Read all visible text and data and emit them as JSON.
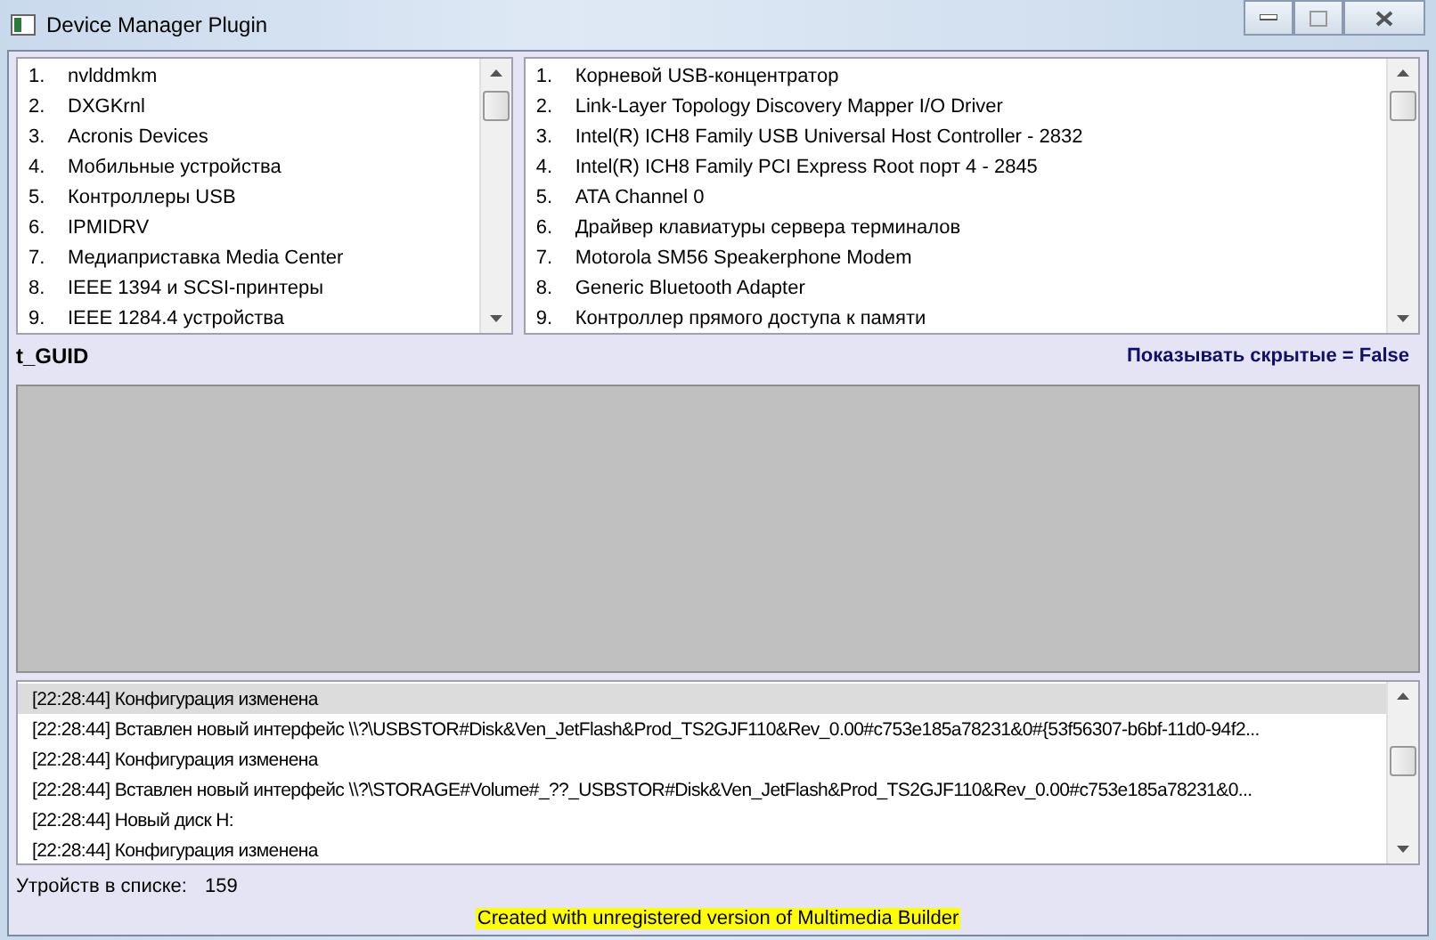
{
  "window": {
    "title": "Device Manager Plugin"
  },
  "classes_list": {
    "items": [
      {
        "number": "1.",
        "name": "nvlddmkm"
      },
      {
        "number": "2.",
        "name": "DXGKrnl"
      },
      {
        "number": "3.",
        "name": "Acronis Devices"
      },
      {
        "number": "4.",
        "name": "Мобильные устройства"
      },
      {
        "number": "5.",
        "name": "Контроллеры USB"
      },
      {
        "number": "6.",
        "name": "IPMIDRV"
      },
      {
        "number": "7.",
        "name": "Медиаприставка Media Center"
      },
      {
        "number": "8.",
        "name": "IEEE 1394 и SCSI-принтеры"
      },
      {
        "number": "9.",
        "name": "IEEE 1284.4 устройства"
      }
    ]
  },
  "devices_list": {
    "items": [
      {
        "number": "1.",
        "name": "Корневой USB-концентратор"
      },
      {
        "number": "2.",
        "name": "Link-Layer Topology Discovery Mapper I/O Driver"
      },
      {
        "number": "3.",
        "name": "Intel(R) ICH8 Family USB Universal Host Controller - 2832"
      },
      {
        "number": "4.",
        "name": "Intel(R) ICH8 Family PCI Express Root порт 4 - 2845"
      },
      {
        "number": "5.",
        "name": "ATA Channel 0"
      },
      {
        "number": "6.",
        "name": "Драйвер клавиатуры сервера терминалов"
      },
      {
        "number": "7.",
        "name": "Motorola SM56 Speakerphone Modem"
      },
      {
        "number": "8.",
        "name": "Generic Bluetooth Adapter"
      },
      {
        "number": "9.",
        "name": "Контроллер прямого доступа к памяти"
      }
    ]
  },
  "guid_label": "t_GUID",
  "show_hidden_label": "Показывать скрытые = False",
  "log": {
    "rows": [
      {
        "text": "[22:28:44] Конфигурация изменена",
        "selected": true
      },
      {
        "text": "[22:28:44] Вставлен новый интерфейс \\\\?\\USBSTOR#Disk&Ven_JetFlash&Prod_TS2GJF110&Rev_0.00#c753e185a78231&0#{53f56307-b6bf-11d0-94f2...",
        "selected": false
      },
      {
        "text": "[22:28:44] Конфигурация изменена",
        "selected": false
      },
      {
        "text": "[22:28:44] Вставлен новый интерфейс \\\\?\\STORAGE#Volume#_??_USBSTOR#Disk&Ven_JetFlash&Prod_TS2GJF110&Rev_0.00#c753e185a78231&0...",
        "selected": false
      },
      {
        "text": "[22:28:44] Новый диск H:",
        "selected": false
      },
      {
        "text": "[22:28:44] Конфигурация изменена",
        "selected": false
      }
    ]
  },
  "count": {
    "label": "Утройств в списке:",
    "value": "159"
  },
  "banner": "Created with unregistered version of Multimedia Builder"
}
